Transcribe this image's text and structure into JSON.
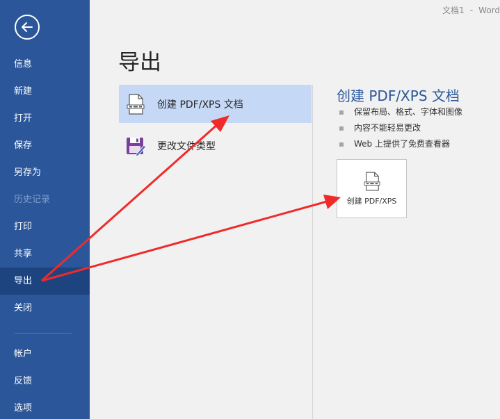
{
  "titlebar": {
    "doc_name": "文档1",
    "separator": "-",
    "app_name": "Word"
  },
  "sidebar": {
    "back_icon": "back-arrow-icon",
    "items": [
      {
        "label": "信息",
        "state": "normal"
      },
      {
        "label": "新建",
        "state": "normal"
      },
      {
        "label": "打开",
        "state": "normal"
      },
      {
        "label": "保存",
        "state": "normal"
      },
      {
        "label": "另存为",
        "state": "normal"
      },
      {
        "label": "历史记录",
        "state": "disabled"
      },
      {
        "label": "打印",
        "state": "normal"
      },
      {
        "label": "共享",
        "state": "normal"
      },
      {
        "label": "导出",
        "state": "active"
      },
      {
        "label": "关闭",
        "state": "normal"
      }
    ],
    "bottom_items": [
      {
        "label": "帐户"
      },
      {
        "label": "反馈"
      },
      {
        "label": "选项"
      }
    ]
  },
  "main": {
    "title": "导出",
    "options": [
      {
        "label": "创建 PDF/XPS 文档",
        "icon": "pdf-document-icon",
        "selected": true
      },
      {
        "label": "更改文件类型",
        "icon": "save-file-type-icon",
        "selected": false
      }
    ],
    "detail": {
      "title": "创建 PDF/XPS 文档",
      "bullets": [
        "保留布局、格式、字体和图像",
        "内容不能轻易更改",
        "Web 上提供了免费查看器"
      ],
      "button_label": "创建 PDF/XPS",
      "button_icon": "pdf-document-icon"
    }
  },
  "colors": {
    "sidebar_bg": "#2b579a",
    "sidebar_active": "#1e4480",
    "selected_option": "#c5d8f5",
    "accent_text": "#2b579a",
    "annotation_arrow": "#f02a2a"
  }
}
